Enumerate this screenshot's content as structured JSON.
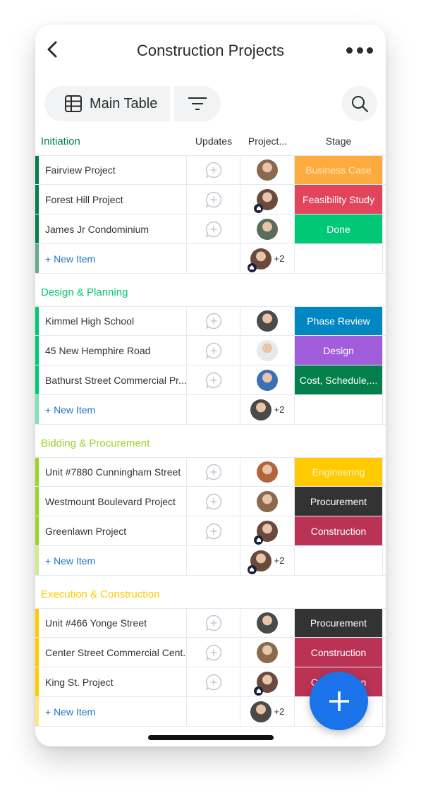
{
  "header": {
    "title": "Construction Projects"
  },
  "toolbar": {
    "main_table_label": "Main Table"
  },
  "columns": {
    "updates": "Updates",
    "project": "Project...",
    "stage": "Stage"
  },
  "groups": [
    {
      "title": "Initiation",
      "color": "#037f4c",
      "bar_light": "#68a98b",
      "rows": [
        {
          "name": "Fairview Project",
          "stage": "Business Case",
          "stage_color": "#fdab3d",
          "stage_text_color": "#fde7c4",
          "avatar_color": "#8a6a4e",
          "home": false
        },
        {
          "name": "Forest Hill Project",
          "stage": "Feasibility Study",
          "stage_color": "#e2445c",
          "stage_text_color": "#ffffff",
          "avatar_color": "#6b4a3e",
          "home": true
        },
        {
          "name": "James Jr Condominium",
          "stage": "Done",
          "stage_color": "#00c875",
          "stage_text_color": "#ffffff",
          "avatar_color": "#5b6d5a",
          "home": false
        }
      ],
      "new_item": {
        "label": "+ New Item",
        "count": "+2",
        "avatar_color": "#6b4a3e",
        "home": true
      }
    },
    {
      "title": "Design & Planning",
      "color": "#00c875",
      "bar_light": "#7fe0b5",
      "rows": [
        {
          "name": "Kimmel High School",
          "stage": "Phase Review",
          "stage_color": "#0086c0",
          "stage_text_color": "#ffffff",
          "avatar_color": "#4a4a4a",
          "home": false
        },
        {
          "name": "45 New Hemphire Road",
          "stage": "Design",
          "stage_color": "#a25ddc",
          "stage_text_color": "#ffffff",
          "avatar_color": "#e9e9e9",
          "home": false
        },
        {
          "name": "Bathurst Street Commercial Pr...",
          "stage": "Cost, Schedule,...",
          "stage_color": "#037f4c",
          "stage_text_color": "#ffffff",
          "avatar_color": "#3b6fb6",
          "home": false
        }
      ],
      "new_item": {
        "label": "+ New Item",
        "count": "+2",
        "avatar_color": "#4a4a4a",
        "home": false
      }
    },
    {
      "title": "Bidding & Procurement",
      "color": "#9cd326",
      "bar_light": "#cdea94",
      "rows": [
        {
          "name": "Unit #7880 Cunningham Street",
          "stage": "Engineering",
          "stage_color": "#ffcb00",
          "stage_text_color": "#fff2c2",
          "avatar_color": "#b4643c",
          "home": false
        },
        {
          "name": "Westmount Boulevard Project",
          "stage": "Procurement",
          "stage_color": "#333333",
          "stage_text_color": "#ffffff",
          "avatar_color": "#8a6a4e",
          "home": false
        },
        {
          "name": "Greenlawn Project",
          "stage": "Construction",
          "stage_color": "#bb3354",
          "stage_text_color": "#ffffff",
          "avatar_color": "#6b4a3e",
          "home": true
        }
      ],
      "new_item": {
        "label": "+ New Item",
        "count": "+2",
        "avatar_color": "#6b4a3e",
        "home": true
      }
    },
    {
      "title": "Execution & Construction",
      "color": "#ffcb00",
      "bar_light": "#ffe580",
      "rows": [
        {
          "name": "Unit #466 Yonge Street",
          "stage": "Procurement",
          "stage_color": "#333333",
          "stage_text_color": "#ffffff",
          "avatar_color": "#4a4a4a",
          "home": false
        },
        {
          "name": "Center Street Commercial Cent...",
          "stage": "Construction",
          "stage_color": "#bb3354",
          "stage_text_color": "#ffffff",
          "avatar_color": "#8a6a4e",
          "home": false
        },
        {
          "name": "King St. Project",
          "stage": "Construction",
          "stage_color": "#bb3354",
          "stage_text_color": "#ffffff",
          "avatar_color": "#6b4a3e",
          "home": true
        }
      ],
      "new_item": {
        "label": "+ New Item",
        "count": "+2",
        "avatar_color": "#4a4a4a",
        "home": false
      }
    }
  ],
  "colors": {
    "accent": "#1a73e8",
    "new_item_link": "#1f76c2"
  }
}
